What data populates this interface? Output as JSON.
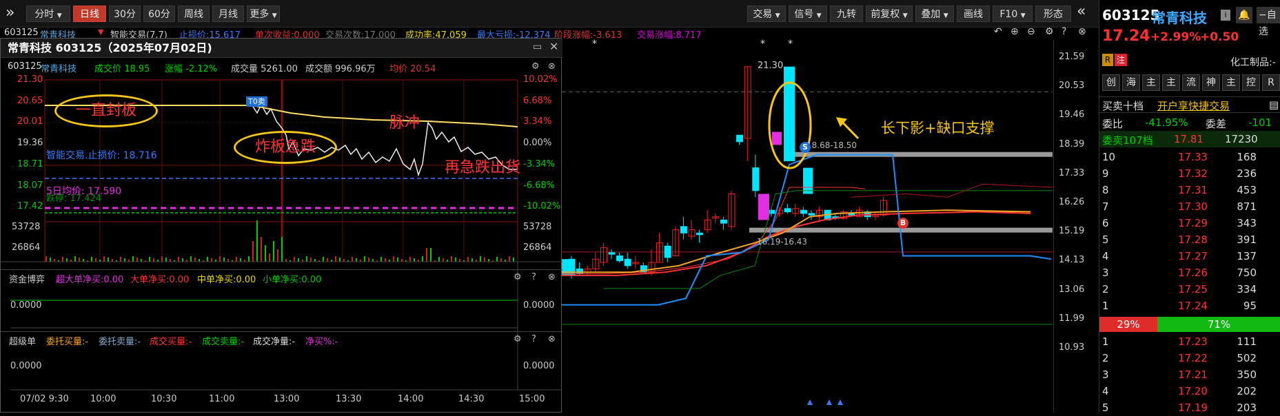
{
  "toolbar": {
    "tabs": [
      "分时",
      "日线",
      "30分",
      "60分",
      "周线",
      "月线",
      "更多"
    ],
    "right": [
      "交易",
      "信号",
      "九转",
      "前复权",
      "叠加",
      "画线",
      "F10",
      "形态"
    ]
  },
  "infobar": {
    "code": "603125",
    "name": "常青科技",
    "items": [
      {
        "text": "智能交易(7.7)",
        "color": "#cfcfcf"
      },
      {
        "text": "止损价:15.617",
        "color": "#3a7bff"
      },
      {
        "text": "单次收益:0.000",
        "color": "#d33"
      },
      {
        "text": "交易次数:17.000",
        "color": "#777"
      },
      {
        "text": "成功率:47.059",
        "color": "#e8d800"
      },
      {
        "text": "最大亏损:-12.374",
        "color": "#3a7bff"
      },
      {
        "text": "阶段涨幅:-3.613",
        "color": "#d33"
      },
      {
        "text": "交易涨幅:8.717",
        "color": "#d0d"
      }
    ]
  },
  "kline": {
    "y_labels": [
      "21.59",
      "20.53",
      "19.46",
      "18.39",
      "17.33",
      "16.26",
      "15.19",
      "14.13",
      "13.06",
      "11.99",
      "10.93"
    ],
    "high_label": "21.30",
    "annotation": "长下影+缺口支撑",
    "zone_upper": "18.68-18.50",
    "zone_lower": "16.19-16.43",
    "sell_mark": "S",
    "buy_mark": "B",
    "star": "*",
    "colors": {
      "up": "#ff1e1e",
      "down": "#00e5ff",
      "ma_orange": "#f5a623",
      "ma_blue": "#1e90ff",
      "gap": "#9a9a9a",
      "circle": "#f5c518"
    }
  },
  "popup": {
    "title": "常青科技 603125（2025年07月02日)",
    "header": {
      "code": "603125",
      "name": "常青科技",
      "price": "成交价 18.95",
      "change": "涨幅 -2.12%",
      "volume": "成交量 5261.00",
      "amount": "成交额 996.96万",
      "avg": "均价 20.54"
    },
    "left_prices": [
      "21.30",
      "20.65",
      "20.01",
      "19.36",
      "18.71",
      "18.07",
      "17.42"
    ],
    "right_pcts": [
      "10.02%",
      "6.68%",
      "3.34%",
      "0.00%",
      "-3.34%",
      "-6.68%",
      "-10.02%"
    ],
    "vol_labels": [
      "53728",
      "26864"
    ],
    "stop_line": "智能交易.止损价: 18.716",
    "ma5_line": "5日均价: 17.590",
    "zhangting": "跌停: 17.424",
    "t0_mark": "T0卖",
    "notes": {
      "n1": "一直封板",
      "n2": "炸板急跌",
      "n3": "脉冲",
      "n4": "再急跌出货"
    },
    "fund": {
      "title": "资金博弈",
      "super": "超大单净买:0.00",
      "big": "大单净买:0.00",
      "mid": "中单净买:0.00",
      "small": "小单净买:0.00",
      "value": "0.0000"
    },
    "super": {
      "title": "超级单",
      "a": "委托买量:-",
      "b": "委托卖量:-",
      "c": "成交买量:-",
      "d": "成交卖量:-",
      "e": "成交净量:-",
      "f": "净买%:-",
      "value": "0.0000"
    },
    "time_labels": [
      "07/02 9:30",
      "10:00",
      "10:30",
      "11:00",
      "13:00",
      "13:30",
      "14:00",
      "14:30",
      "15:00"
    ]
  },
  "right_panel": {
    "code": "603125",
    "name": "常青科技",
    "price": "17.24",
    "pct": "+2.99%",
    "chg": "+0.50",
    "tag1": "R",
    "tag2": "注",
    "industry": "化工制品:-",
    "nav": [
      "创",
      "海",
      "主",
      "主",
      "流",
      "神",
      "主",
      "控",
      "R"
    ],
    "trade_tabs": {
      "a": "买卖十档",
      "b": "开户享快捷交易"
    },
    "weibi": "委比",
    "weibi_val": "-41.95%",
    "weicha": "委差",
    "weicha_val": "-101",
    "weimai": "委卖107档",
    "weimai_price": "17.81",
    "weimai_vol": "17230",
    "sells": [
      {
        "lvl": "10",
        "price": "17.33",
        "vol": "168"
      },
      {
        "lvl": "9",
        "price": "17.32",
        "vol": "236"
      },
      {
        "lvl": "8",
        "price": "17.31",
        "vol": "453"
      },
      {
        "lvl": "7",
        "price": "17.30",
        "vol": "871"
      },
      {
        "lvl": "6",
        "price": "17.29",
        "vol": "343"
      },
      {
        "lvl": "5",
        "price": "17.28",
        "vol": "391"
      },
      {
        "lvl": "4",
        "price": "17.27",
        "vol": "137"
      },
      {
        "lvl": "3",
        "price": "17.26",
        "vol": "750"
      },
      {
        "lvl": "2",
        "price": "17.25",
        "vol": "334"
      },
      {
        "lvl": "1",
        "price": "17.24",
        "vol": "95"
      }
    ],
    "ratio_buy": "29%",
    "ratio_sell": "71%",
    "buys": [
      {
        "lvl": "1",
        "price": "17.23",
        "vol": "111"
      },
      {
        "lvl": "2",
        "price": "17.22",
        "vol": "502"
      },
      {
        "lvl": "3",
        "price": "17.21",
        "vol": "350"
      },
      {
        "lvl": "4",
        "price": "17.20",
        "vol": "202"
      },
      {
        "lvl": "5",
        "price": "17.19",
        "vol": "203"
      }
    ],
    "self_select": "自选"
  }
}
